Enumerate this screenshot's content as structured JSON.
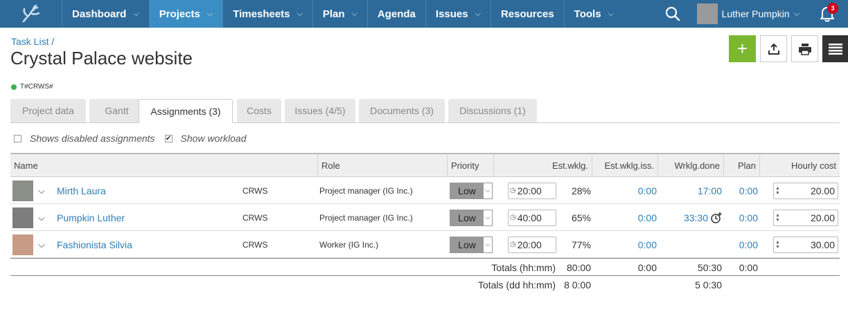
{
  "nav": {
    "items": [
      {
        "label": "Dashboard",
        "has_menu": true
      },
      {
        "label": "Projects",
        "has_menu": true,
        "active": true
      },
      {
        "label": "Timesheets",
        "has_menu": true
      },
      {
        "label": "Plan",
        "has_menu": true
      },
      {
        "label": "Agenda",
        "has_menu": false
      },
      {
        "label": "Issues",
        "has_menu": true
      },
      {
        "label": "Resources",
        "has_menu": false
      },
      {
        "label": "Tools",
        "has_menu": true
      }
    ],
    "user_name": "Luther Pumpkin",
    "notification_count": "3",
    "bar_color": "#2d6a9a",
    "active_color": "#3b8ec4"
  },
  "header": {
    "breadcrumb": "Task List /",
    "title": "Crystal Palace website",
    "project_code": "T#CRWS#",
    "status_color": "#3cb34b",
    "add_label": "+"
  },
  "tabs": [
    {
      "label": "Project data"
    },
    {
      "label": "Gantt"
    },
    {
      "label": "Assignments (3)",
      "active": true
    },
    {
      "label": "Costs"
    },
    {
      "label": "Issues (4/5)"
    },
    {
      "label": "Documents (3)"
    },
    {
      "label": "Discussions (1)"
    }
  ],
  "options": {
    "show_disabled_label": "Shows disabled assignments",
    "show_disabled_checked": false,
    "show_workload_label": "Show workload",
    "show_workload_checked": true
  },
  "grid": {
    "headers": {
      "name": "Name",
      "role": "Role",
      "priority": "Priority",
      "est_wklg": "Est.wklg.",
      "est_wklg_iss": "Est.wklg.iss.",
      "wrklg_done": "Wrklg.done",
      "plan": "Plan",
      "hourly_cost": "Hourly cost"
    },
    "rows": [
      {
        "name": "Mirth Laura",
        "code": "CRWS",
        "role": "Project manager (IG Inc.)",
        "priority": "Low",
        "est_wklg": "20:00",
        "percent": "28%",
        "est_wklg_iss": "0:00",
        "wrklg_done": "17:00",
        "plan": "0:00",
        "hourly_cost": "20.00"
      },
      {
        "name": "Pumpkin Luther",
        "code": "CRWS",
        "role": "Project manager (IG Inc.)",
        "priority": "Low",
        "est_wklg": "40:00",
        "percent": "65%",
        "est_wklg_iss": "0:00",
        "wrklg_done": "33:30",
        "plan": "0:00",
        "hourly_cost": "20.00"
      },
      {
        "name": "Fashionista Silvia",
        "code": "CRWS",
        "role": "Worker (IG Inc.)",
        "priority": "Low",
        "est_wklg": "20:00",
        "percent": "77%",
        "est_wklg_iss": "0:00",
        "wrklg_done": "",
        "plan": "0:00",
        "hourly_cost": "30.00"
      }
    ],
    "totals_hhmm": {
      "label": "Totals (hh:mm)",
      "est_wklg": "80:00",
      "est_wklg_iss": "0:00",
      "wrklg_done": "50:30",
      "plan": "0:00"
    },
    "totals_ddhhmm": {
      "label": "Totals (dd hh:mm)",
      "est_wklg": "8 0:00",
      "wrklg_done": "5 0:30"
    }
  }
}
